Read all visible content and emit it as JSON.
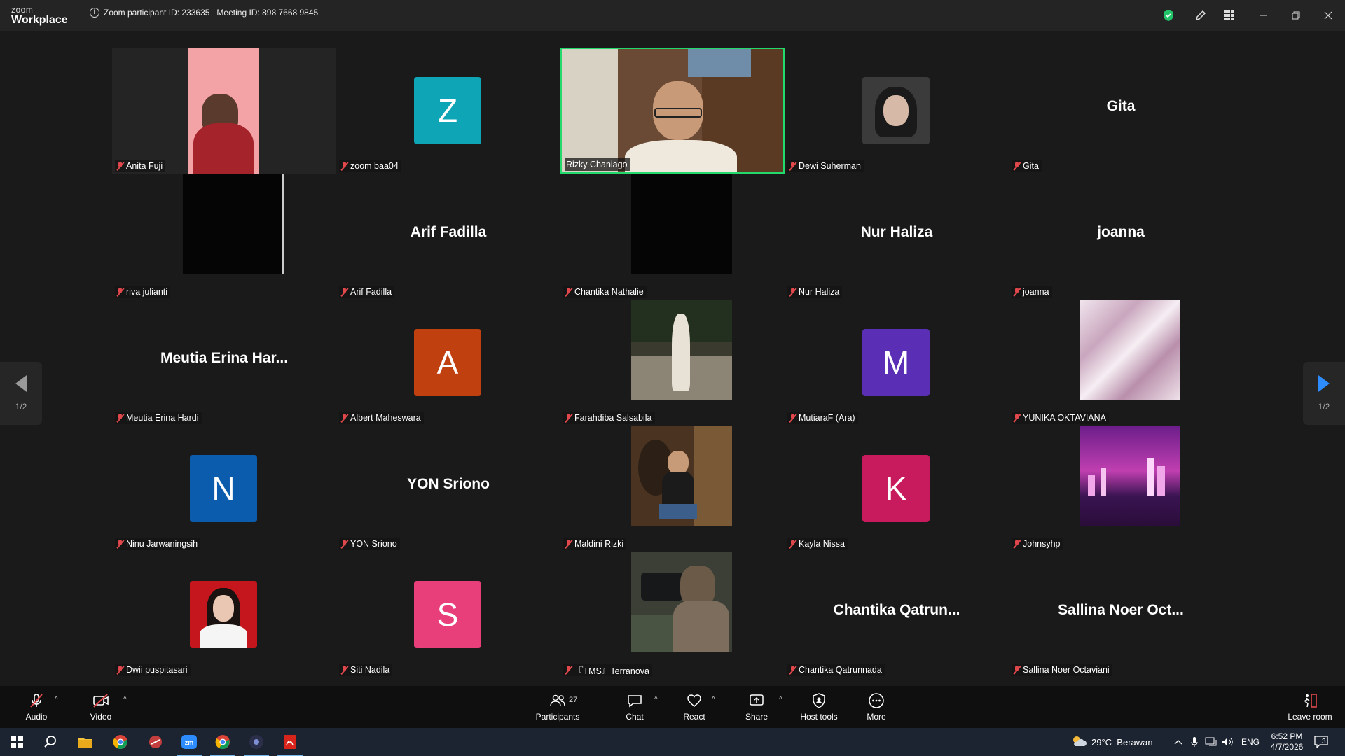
{
  "titlebar": {
    "brand_top": "zoom",
    "brand_bottom": "Workplace",
    "meeting_info": "Zoom participant ID: 233635   Meeting ID: 898 7668 9845"
  },
  "pager": {
    "left": "1/2",
    "right": "1/2"
  },
  "participants": [
    {
      "name": "Anita Fuji",
      "kind": "video"
    },
    {
      "name": "zoom baa04",
      "kind": "avatar",
      "initial": "Z",
      "color": "#0ea5b7"
    },
    {
      "name": "Rizky Chaniago",
      "kind": "video",
      "active": true
    },
    {
      "name": "Dewi Suherman",
      "kind": "photo"
    },
    {
      "name": "Gita",
      "kind": "text",
      "display": "Gita"
    },
    {
      "name": "riva julianti",
      "kind": "dark"
    },
    {
      "name": "Arif Fadilla",
      "kind": "text",
      "display": "Arif Fadilla"
    },
    {
      "name": "Chantika Nathalie",
      "kind": "dark"
    },
    {
      "name": "Nur Haliza",
      "kind": "text",
      "display": "Nur Haliza"
    },
    {
      "name": "joanna",
      "kind": "text",
      "display": "joanna"
    },
    {
      "name": "Meutia Erina Hardi",
      "kind": "text",
      "display": "Meutia Erina Har..."
    },
    {
      "name": "Albert Maheswara",
      "kind": "avatar",
      "initial": "A",
      "color": "#c0400f"
    },
    {
      "name": "Farahdiba Salsabila",
      "kind": "photo-lg"
    },
    {
      "name": "MutiaraF (Ara)",
      "kind": "avatar",
      "initial": "M",
      "color": "#5b2fb5"
    },
    {
      "name": "YUNIKA OKTAVIANA",
      "kind": "photo-lg"
    },
    {
      "name": "Ninu Jarwaningsih",
      "kind": "avatar",
      "initial": "N",
      "color": "#0b5cad"
    },
    {
      "name": "YON Sriono",
      "kind": "text",
      "display": "YON Sriono"
    },
    {
      "name": "Maldini Rizki",
      "kind": "photo-lg"
    },
    {
      "name": "Kayla Nissa",
      "kind": "avatar",
      "initial": "K",
      "color": "#c81b5d"
    },
    {
      "name": "Johnsyhp",
      "kind": "photo-lg"
    },
    {
      "name": "Dwii puspitasari",
      "kind": "photo"
    },
    {
      "name": "Siti Nadila",
      "kind": "avatar",
      "initial": "S",
      "color": "#e83e7a"
    },
    {
      "name": "『TMS』Terranova",
      "kind": "photo-lg"
    },
    {
      "name": "Chantika Qatrunnada",
      "kind": "text",
      "display": "Chantika Qatrun..."
    },
    {
      "name": "Sallina Noer Octaviani",
      "kind": "text",
      "display": "Sallina Noer Oct..."
    }
  ],
  "toolbar": {
    "audio": "Audio",
    "video": "Video",
    "participants": "Participants",
    "participants_count": "27",
    "chat": "Chat",
    "react": "React",
    "share": "Share",
    "host_tools": "Host tools",
    "more": "More",
    "leave": "Leave room"
  },
  "taskbar": {
    "weather": "29°C  Berawan",
    "lang": "ENG",
    "time": "6:52 PM",
    "date": "4/7/2026",
    "notifications": "3"
  },
  "colors": {
    "accent": "#2d8cff",
    "active_border": "#23d96c",
    "muted": "#e0484c"
  }
}
